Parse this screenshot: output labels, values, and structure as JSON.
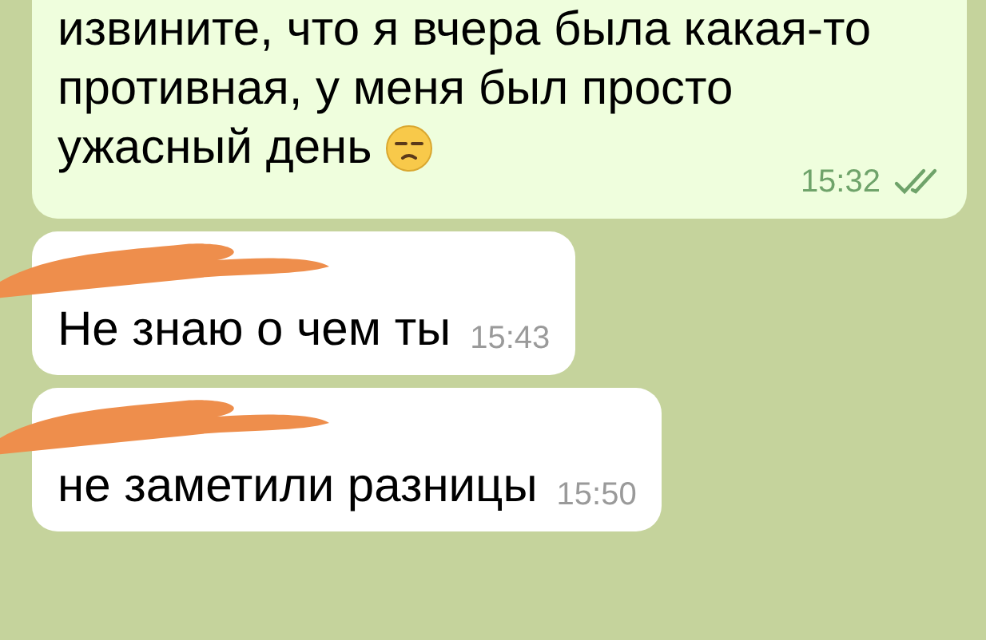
{
  "messages": [
    {
      "kind": "outgoing",
      "lines": [
        "извините, что я вчера была какая-то",
        "противная, у меня был просто",
        "ужасный день"
      ],
      "time": "15:32",
      "read": true,
      "redacted": false
    },
    {
      "kind": "incoming",
      "lines": [
        "Не знаю о чем ты"
      ],
      "time": "15:43",
      "redacted": true
    },
    {
      "kind": "incoming",
      "lines": [
        "не заметили разницы"
      ],
      "time": "15:50",
      "redacted": true
    }
  ]
}
